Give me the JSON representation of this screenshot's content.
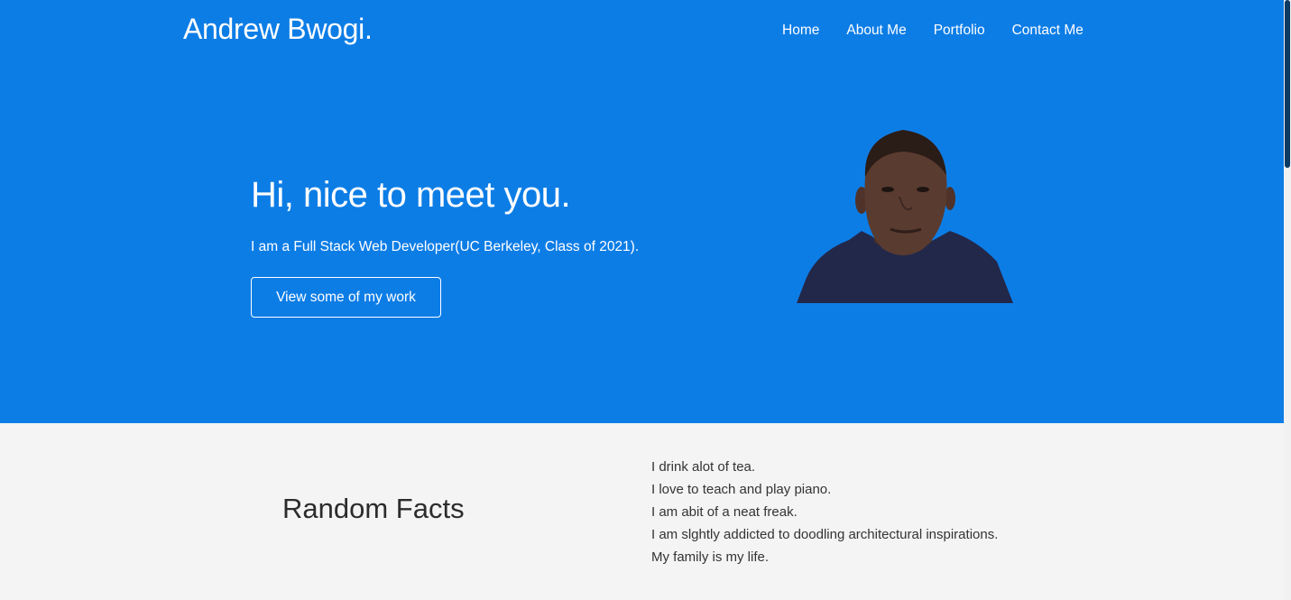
{
  "header": {
    "brand": "Andrew Bwogi.",
    "nav": [
      "Home",
      "About Me",
      "Portfolio",
      "Contact Me"
    ]
  },
  "hero": {
    "greeting": "Hi, nice to meet you.",
    "tagline": "I am a Full Stack Web Developer(UC Berkeley, Class of 2021).",
    "cta_label": "View some of my work"
  },
  "facts": {
    "title": "Random Facts",
    "items": [
      "I drink alot of tea.",
      "I love to teach and play piano.",
      "I am abit of a neat freak.",
      "I am slghtly addicted to doodling architectural inspirations.",
      "My family is my life."
    ]
  },
  "colors": {
    "hero_bg": "#0d7de6",
    "section_bg": "#f4f4f4",
    "text_light": "#ffffff",
    "text_dark": "#333333"
  }
}
